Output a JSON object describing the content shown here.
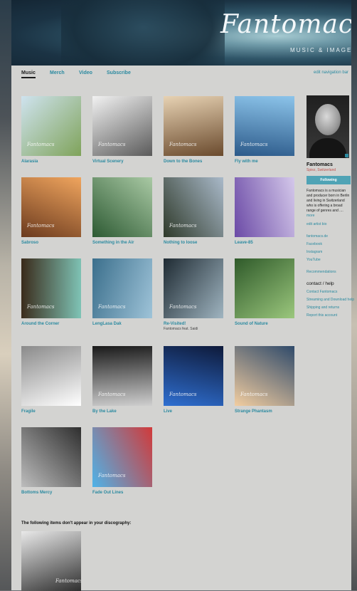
{
  "header": {
    "logo_text": "Fantomacs",
    "logo_subtitle": "MUSIC & IMAGES"
  },
  "nav": {
    "tabs": [
      "Music",
      "Merch",
      "Video",
      "Subscribe"
    ],
    "active": "Music",
    "edit_label": "edit navigation bar"
  },
  "albums": [
    {
      "title": "Alarasia",
      "cover_text": "Fantomacs",
      "colors": [
        "#cfe3ef",
        "#7fa35a"
      ]
    },
    {
      "title": "Virtual Scenery",
      "cover_text": "Fantomacs",
      "colors": [
        "#f2f2f2",
        "#5a5a5a"
      ]
    },
    {
      "title": "Down to the Bones",
      "cover_text": "Fantomacs",
      "colors": [
        "#e7d2b3",
        "#6a4a2d"
      ]
    },
    {
      "title": "Fly with me",
      "cover_text": "Fantomacs",
      "colors": [
        "#8cc4ea",
        "#2c5a8a"
      ]
    },
    {
      "title": "Sabroso",
      "cover_text": "Fantomacs",
      "colors": [
        "#f0a55e",
        "#6b3a1e"
      ]
    },
    {
      "title": "Something in the Air",
      "cover_text": "",
      "colors": [
        "#a9c9a4",
        "#2d5a33"
      ]
    },
    {
      "title": "Nothing to loose",
      "cover_text": "Fantomacs",
      "colors": [
        "#a9b9c9",
        "#2f3a2a"
      ]
    },
    {
      "title": "Leave-85",
      "cover_text": "",
      "colors": [
        "#d4c8ea",
        "#6b4aa6"
      ]
    },
    {
      "title": "Around the Corner",
      "cover_text": "Fantomacs",
      "colors": [
        "#7fc4b6",
        "#3a2a1a"
      ]
    },
    {
      "title": "LengLasa Dak",
      "cover_text": "Fantomacs",
      "colors": [
        "#9ec3d8",
        "#3b6f8c"
      ]
    },
    {
      "title": "Re-Visited!",
      "cover_text": "Fantomacs",
      "colors": [
        "#9fb4c0",
        "#1f2b33"
      ],
      "artist": "Fantomacs feat. Saidi"
    },
    {
      "title": "Sound of Nature",
      "cover_text": "",
      "colors": [
        "#9bc77d",
        "#2f5a2a"
      ]
    },
    {
      "title": "Fragile",
      "cover_text": "",
      "colors": [
        "#ffffff",
        "#8a8a8a"
      ]
    },
    {
      "title": "By the Lake",
      "cover_text": "Fantomacs",
      "colors": [
        "#cfcfcf",
        "#1a1a1a"
      ]
    },
    {
      "title": "Live",
      "cover_text": "Fantomacs",
      "colors": [
        "#2f6fd1",
        "#0e1a3a"
      ]
    },
    {
      "title": "Strange Phantasm",
      "cover_text": "Fantomacs",
      "colors": [
        "#f2cda0",
        "#2f4a6a"
      ]
    },
    {
      "title": "Bottoms Mercy",
      "cover_text": "",
      "colors": [
        "#bdbdbd",
        "#2f2f2f"
      ]
    },
    {
      "title": "Fade Out Lines",
      "cover_text": "Fantomacs",
      "colors": [
        "#4fb3e8",
        "#d13a3a"
      ]
    }
  ],
  "sidebar": {
    "name": "Fantomacs",
    "location": "Spiez, Switzerland",
    "follow_label": "Following",
    "bio": "Fantomacs is a musician and producer born in Berlin and living in Switzerland who is offering a broad range of genres and ....",
    "bio_more": "more",
    "edit_artist_bio": "edit artist bio",
    "links": [
      "fantomacs.de",
      "Facebook",
      "Instagram",
      "YouTube"
    ],
    "recommendations": "Recommendations",
    "contact_heading": "contact / help",
    "contact_links": [
      "Contact Fantomacs",
      "Streaming and Download help",
      "Shipping and returns",
      "Report this account"
    ]
  },
  "extra_section": {
    "label": "The following items don't appear in your discography:",
    "cover_text": "Fantomacs",
    "colors": [
      "#e9e9e9",
      "#2f2f2f"
    ]
  }
}
